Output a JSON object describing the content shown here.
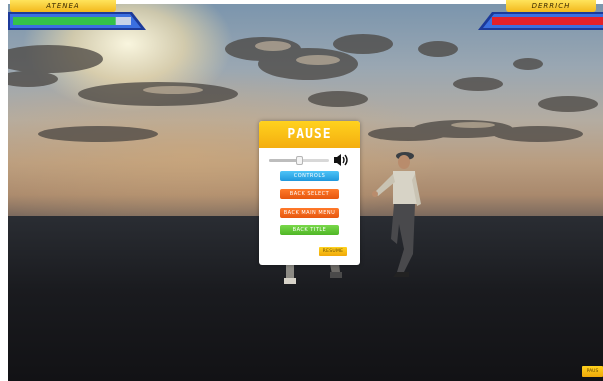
{
  "hud": {
    "player1": {
      "name": "ATENEA",
      "health": 0.87
    },
    "player2": {
      "name": "DERRICH",
      "health": 1.0
    }
  },
  "pause_menu": {
    "title": "PAUSE",
    "volume": 0.5,
    "buttons": {
      "controls": "CONTROLS",
      "back_select": "BACK SELECT",
      "back_main_menu": "BACK MAIN MENU",
      "back_title": "BACK TITLE",
      "resume": "RESUME"
    }
  },
  "corner_pause_label": "PAUS",
  "colors": {
    "accent_yellow": "#f7c315",
    "p1_health_green": "#34c24a",
    "p2_health_red": "#e4212a",
    "frame_blue": "#2a5ad6",
    "controls_blue": "#2aa6e6",
    "orange": "#f0661a",
    "green": "#5cc232"
  },
  "icons": {
    "volume": "speaker-icon"
  }
}
